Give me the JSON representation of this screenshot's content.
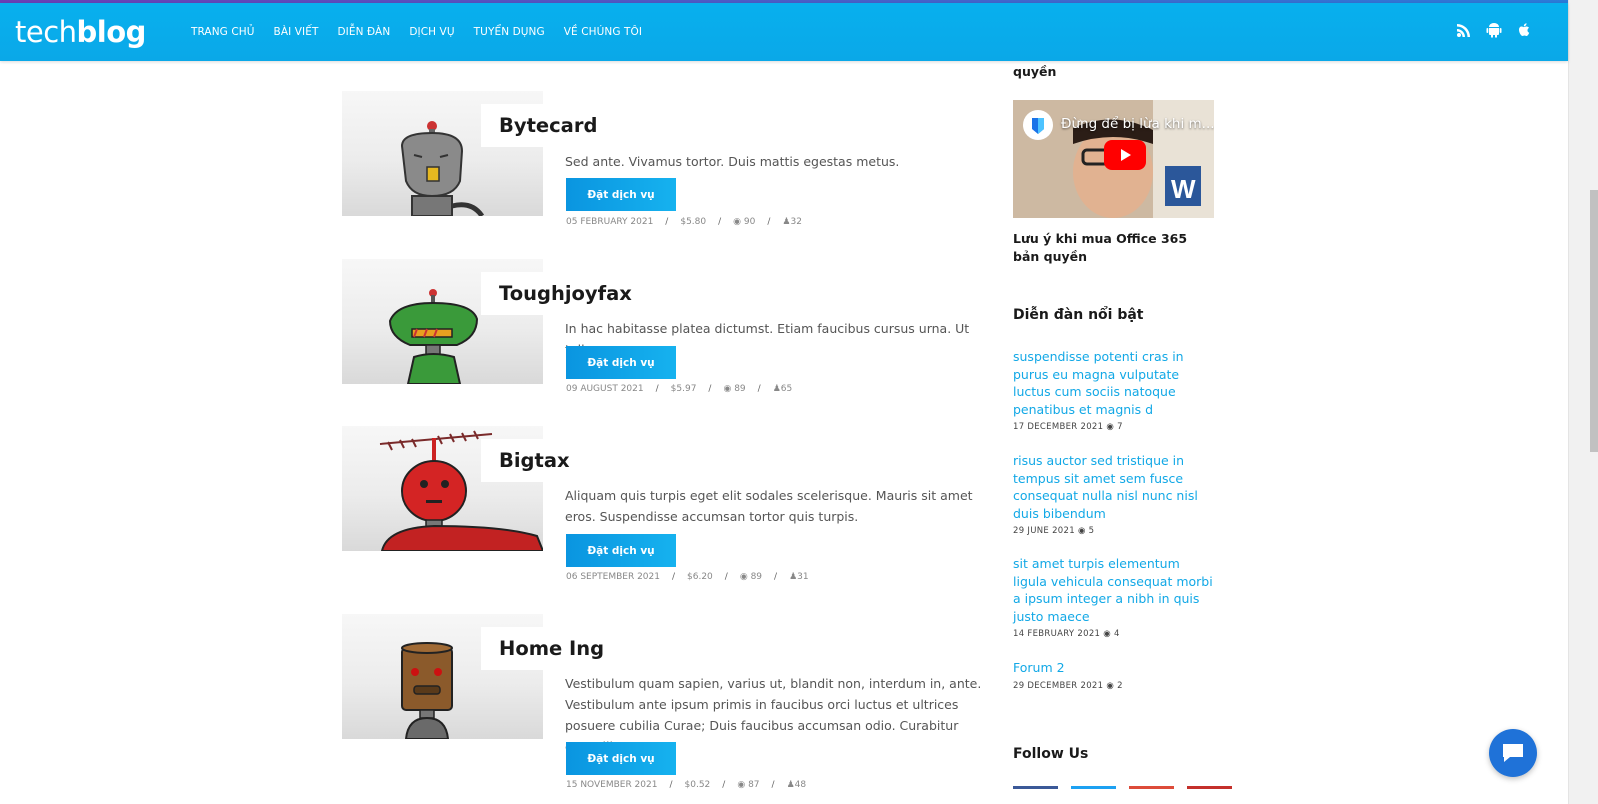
{
  "header": {
    "logo_light": "tech",
    "logo_bold": "blog",
    "nav": [
      "TRANG CHỦ",
      "BÀI VIẾT",
      "DIỄN ĐÀN",
      "DỊCH VỤ",
      "TUYỂN DỤNG",
      "VỀ CHÚNG TÔI"
    ],
    "icons": [
      "rss-icon",
      "android-icon",
      "apple-icon"
    ]
  },
  "services": [
    {
      "title": "Bytecard",
      "description": "Sed ante. Vivamus tortor. Duis mattis egestas metus.",
      "button": "Đặt dịch vụ",
      "date": "05 FEBRUARY 2021",
      "price": "$5.80",
      "views": "90",
      "users": "32",
      "robot_color": "#8a8a8a"
    },
    {
      "title": "Toughjoyfax",
      "description": "In hac habitasse platea dictumst. Etiam faucibus cursus urna. Ut tellus.",
      "button": "Đặt dịch vụ",
      "date": "09 AUGUST 2021",
      "price": "$5.97",
      "views": "89",
      "users": "65",
      "robot_color": "#3a9a3a"
    },
    {
      "title": "Bigtax",
      "description": "Aliquam quis turpis eget elit sodales scelerisque. Mauris sit amet eros. Suspendisse accumsan tortor quis turpis.",
      "button": "Đặt dịch vụ",
      "date": "06 SEPTEMBER 2021",
      "price": "$6.20",
      "views": "89",
      "users": "31",
      "robot_color": "#d42424"
    },
    {
      "title": "Home Ing",
      "description": "Vestibulum quam sapien, varius ut, blandit non, interdum in, ante. Vestibulum ante ipsum primis in faucibus orci luctus et ultrices posuere cubilia Curae; Duis faucibus accumsan odio. Curabitur convallis.",
      "button": "Đặt dịch vụ",
      "date": "15 NOVEMBER 2021",
      "price": "$0.52",
      "views": "87",
      "users": "48",
      "robot_color": "#8b5a2b"
    }
  ],
  "sidebar": {
    "top_fragment": "quyền",
    "video_title": "Đừng để bị lừa khi m...",
    "video_caption": "Lưu ý khi mua Office 365 bản quyền",
    "forum_heading": "Diễn đàn nổi bật",
    "forums": [
      {
        "title": "suspendisse potenti cras in purus eu magna vulputate luctus cum sociis natoque penatibus et magnis d",
        "date": "17 DECEMBER 2021",
        "views": "7"
      },
      {
        "title": "risus auctor sed tristique in tempus sit amet sem fusce consequat nulla nisl nunc nisl duis bibendum",
        "date": "29 JUNE 2021",
        "views": "5"
      },
      {
        "title": "sit amet turpis elementum ligula vehicula consequat morbi a ipsum integer a nibh in quis justo maece",
        "date": "14 FEBRUARY 2021",
        "views": "4"
      },
      {
        "title": "Forum 2",
        "date": "29 DECEMBER 2021",
        "views": "2"
      }
    ],
    "follow_heading": "Follow Us",
    "follow_colors": [
      "#3b5998",
      "#1da1f2",
      "#dd4b39",
      "#c4302b"
    ]
  },
  "colors": {
    "header": "#0aa8e8",
    "link": "#12a8e6",
    "button": "#0a9ee4",
    "chat": "#1f72d8"
  }
}
